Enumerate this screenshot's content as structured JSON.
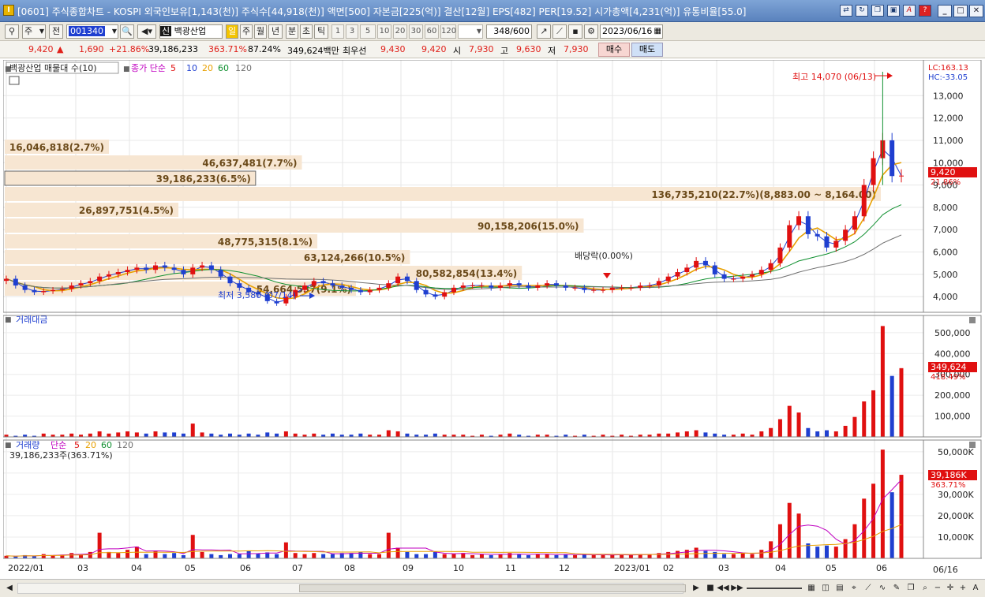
{
  "window": {
    "title": "[0601] 주식종합차트 - KOSPI 외국인보유[1,143(천)] 주식수[44,918(천)] 액면[500] 자본금[225(억)] 결산[12월] EPS[482] PER[19.52] 시가총액[4,231(억)] 유통비율[55.0]",
    "app_icon": "app-icon"
  },
  "toolbar": {
    "period_select": "주",
    "prev_label": "전",
    "code": "001340",
    "stock_badge": "신",
    "stock_name": "백광산업",
    "tabs": [
      "일",
      "주",
      "월",
      "년",
      "분",
      "초",
      "틱"
    ],
    "intervals": [
      "1",
      "3",
      "5",
      "10",
      "20",
      "30",
      "60",
      "120"
    ],
    "count": "348",
    "count_total": "/600",
    "date": "2023/06/16"
  },
  "quote": {
    "price": "9,420",
    "arrow": "▲",
    "change": "1,690",
    "change_pct": "+21.86%",
    "volume": "39,186,233",
    "volume_pct": "363.71%",
    "ratio": "87.24%",
    "amount": "349,624백만",
    "best_label": "최우선",
    "ask": "9,430",
    "bid": "9,420",
    "open_label": "시",
    "open": "7,930",
    "high_label": "고",
    "high": "9,630",
    "low_label": "저",
    "low": "7,930",
    "buy_button": "매수",
    "sell_button": "매도"
  },
  "price_panel": {
    "stock_legend": "백광산업 매물대 수(10)",
    "ma_label": "종가 단순",
    "ma_periods": [
      "5",
      "10",
      "20",
      "60",
      "120"
    ],
    "ma_colors": [
      "#e01010",
      "#1f3fd0",
      "#e8a000",
      "#109030",
      "#707070"
    ],
    "lc": "LC:163.13",
    "hc": "HC:-33.05",
    "last_price": "9,420",
    "last_pct": "21.86%",
    "high_annot": "최고 14,070 (06/13)",
    "low_annot": "최저 3,580 (07/14)",
    "dividend_annot": "배당락(0.00%)"
  },
  "price_axis": {
    "ticks": [
      "13,000",
      "12,000",
      "11,000",
      "10,000",
      "9,000",
      "8,000",
      "7,000",
      "6,000",
      "5,000",
      "4,000"
    ],
    "tick_values": [
      13000,
      12000,
      11000,
      10000,
      9000,
      8000,
      7000,
      6000,
      5000,
      4000
    ]
  },
  "volume_profile": [
    {
      "label": "16,046,818(2.7%)",
      "share": 2.7
    },
    {
      "label": "46,637,481(7.7%)",
      "share": 7.7
    },
    {
      "label": "39,186,233(6.5%)",
      "share": 6.5
    },
    {
      "label": "136,735,210(22.7%)(8,883.00 ~ 8,164.00)",
      "share": 22.7
    },
    {
      "label": "26,897,751(4.5%)",
      "share": 4.5
    },
    {
      "label": "90,158,206(15.0%)",
      "share": 15.0
    },
    {
      "label": "48,775,315(8.1%)",
      "share": 8.1
    },
    {
      "label": "63,124,266(10.5%)",
      "share": 10.5
    },
    {
      "label": "80,582,854(13.4%)",
      "share": 13.4
    },
    {
      "label": "54,664,537(9.1%)",
      "share": 9.1
    }
  ],
  "amount_panel": {
    "title": "거래대금",
    "ticks": [
      "500,000",
      "400,000",
      "300,000",
      "200,000",
      "100,000"
    ],
    "tick_values": [
      500000,
      400000,
      300000,
      200000,
      100000
    ],
    "last_value": "349,624",
    "last_pct": "418.49%"
  },
  "volume_panel": {
    "title": "거래량",
    "ma_label": "단순",
    "ma_periods": [
      "5",
      "20",
      "60",
      "120"
    ],
    "info": "39,186,233주(363.71%)",
    "ticks": [
      "50,000K",
      "40,000K",
      "30,000K",
      "20,000K",
      "10,000K"
    ],
    "tick_values": [
      50000,
      40000,
      30000,
      20000,
      10000
    ],
    "last_value": "39,186K",
    "last_pct": "363.71%"
  },
  "x_axis": {
    "labels": [
      "2022/01",
      "03",
      "04",
      "05",
      "06",
      "07",
      "08",
      "09",
      "10",
      "11",
      "12",
      "2023/01",
      "02",
      "03",
      "04",
      "05",
      "06"
    ],
    "cursor_date": "06/16"
  },
  "chart_data": {
    "type": "candlestick",
    "weekly_close": [
      4800,
      4500,
      4300,
      4200,
      4250,
      4300,
      4350,
      4500,
      4600,
      4700,
      4900,
      5000,
      5100,
      5200,
      5300,
      5200,
      5400,
      5300,
      5200,
      5000,
      5300,
      5400,
      5200,
      4900,
      4600,
      4400,
      4200,
      4100,
      3800,
      3700,
      4000,
      4300,
      4500,
      4700,
      4600,
      4500,
      4400,
      4300,
      4200,
      4300,
      4400,
      4600,
      4900,
      4700,
      4300,
      4100,
      4000,
      4200,
      4400,
      4500,
      4500,
      4500,
      4400,
      4500,
      4600,
      4500,
      4400,
      4500,
      4600,
      4500,
      4400,
      4400,
      4300,
      4300,
      4300,
      4400,
      4400,
      4400,
      4500,
      4500,
      4700,
      4900,
      5100,
      5300,
      5600,
      5400,
      5000,
      4800,
      4800,
      4900,
      5000,
      5200,
      5500,
      6200,
      7200,
      7600,
      6800,
      6700,
      6200,
      6500,
      7000,
      7600,
      9000,
      10200,
      11000,
      9400,
      9420
    ],
    "amount_ratio": [
      0.02,
      0.01,
      0.02,
      0.01,
      0.03,
      0.02,
      0.02,
      0.03,
      0.02,
      0.03,
      0.05,
      0.03,
      0.04,
      0.05,
      0.04,
      0.03,
      0.05,
      0.04,
      0.04,
      0.03,
      0.12,
      0.04,
      0.03,
      0.02,
      0.03,
      0.02,
      0.03,
      0.02,
      0.04,
      0.03,
      0.05,
      0.03,
      0.02,
      0.03,
      0.02,
      0.03,
      0.02,
      0.02,
      0.03,
      0.02,
      0.02,
      0.06,
      0.05,
      0.03,
      0.02,
      0.02,
      0.03,
      0.02,
      0.02,
      0.02,
      0.01,
      0.02,
      0.01,
      0.02,
      0.03,
      0.02,
      0.01,
      0.02,
      0.02,
      0.01,
      0.02,
      0.01,
      0.02,
      0.01,
      0.02,
      0.01,
      0.02,
      0.01,
      0.02,
      0.02,
      0.03,
      0.03,
      0.04,
      0.05,
      0.06,
      0.04,
      0.03,
      0.02,
      0.02,
      0.03,
      0.02,
      0.05,
      0.08,
      0.16,
      0.28,
      0.22,
      0.08,
      0.05,
      0.06,
      0.05,
      0.1,
      0.18,
      0.32,
      0.42,
      1.0,
      0.55,
      0.62
    ],
    "volume_k": [
      1200,
      900,
      1500,
      1000,
      2000,
      1500,
      1700,
      2500,
      1800,
      3000,
      12000,
      3000,
      2500,
      4000,
      5500,
      2000,
      3500,
      2000,
      2500,
      1500,
      11000,
      3000,
      2000,
      1500,
      2000,
      2000,
      3500,
      2200,
      2800,
      2000,
      7500,
      2500,
      2000,
      2500,
      2000,
      2000,
      2500,
      2500,
      3000,
      2000,
      2000,
      12000,
      5000,
      3000,
      2000,
      2000,
      3000,
      2000,
      2000,
      2500,
      1500,
      2000,
      1500,
      2000,
      2500,
      2000,
      1500,
      2000,
      2000,
      1500,
      2000,
      1500,
      2000,
      1500,
      1500,
      1500,
      2000,
      1500,
      2000,
      2000,
      2500,
      3000,
      3500,
      4000,
      5000,
      3500,
      3000,
      2000,
      2000,
      2500,
      2000,
      4000,
      8000,
      16000,
      26000,
      21000,
      7000,
      5500,
      6000,
      5500,
      9000,
      16000,
      28000,
      35000,
      51000,
      31000,
      39186
    ]
  }
}
